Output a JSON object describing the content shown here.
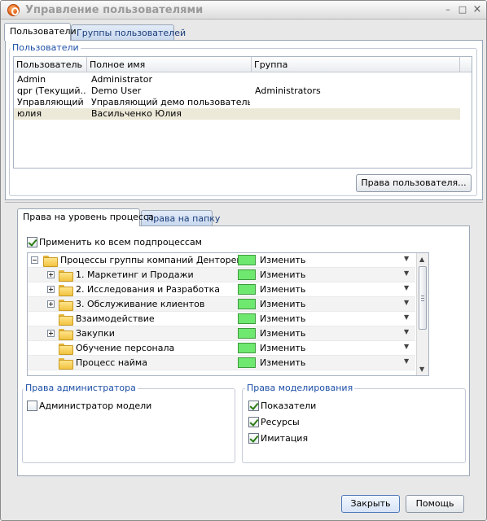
{
  "window": {
    "title": "Управление пользователями",
    "controls": [
      "–",
      "□",
      "×"
    ]
  },
  "top_tabs": [
    {
      "label": "Пользователи",
      "active": true
    },
    {
      "label": "Группы пользователей",
      "active": false
    }
  ],
  "users_group": {
    "label": "Пользователи",
    "columns": [
      "Пользователь",
      "Полное имя",
      "Группа"
    ],
    "rows": [
      {
        "user": "Admin",
        "full_name": "Administrator",
        "group": "",
        "selected": false
      },
      {
        "user": "qpr (Текущий...",
        "full_name": "Demo User",
        "group": "Administrators",
        "selected": false
      },
      {
        "user": "Управляющий",
        "full_name": "Управляющий демо пользователь",
        "group": "",
        "selected": false
      },
      {
        "user": "юлия",
        "full_name": "Васильченко Юлия",
        "group": "",
        "selected": true
      }
    ],
    "rights_button": "Права пользователя..."
  },
  "sub_tabs": [
    {
      "label": "Права на уровень процесса",
      "active": true
    },
    {
      "label": "Права на папку",
      "active": false
    }
  ],
  "apply_all": {
    "label": "Применить ко всем подпроцессам",
    "checked": true
  },
  "tree": {
    "rows": [
      {
        "text": "Процессы группы компаний Денторекс",
        "expander": "minus",
        "indent": 0,
        "permission": "Изменить"
      },
      {
        "text": "1. Маркетинг и Продажи",
        "expander": "plus",
        "indent": 1,
        "permission": "Изменить"
      },
      {
        "text": "2. Исследования и Разработка",
        "expander": "plus",
        "indent": 1,
        "permission": "Изменить"
      },
      {
        "text": "3. Обслуживание клиентов",
        "expander": "plus",
        "indent": 1,
        "permission": "Изменить"
      },
      {
        "text": "Взаимодействие",
        "expander": "none",
        "indent": 1,
        "permission": "Изменить"
      },
      {
        "text": "Закупки",
        "expander": "plus",
        "indent": 1,
        "permission": "Изменить"
      },
      {
        "text": "Обучение персонала",
        "expander": "none",
        "indent": 1,
        "permission": "Изменить"
      },
      {
        "text": "Процесс найма",
        "expander": "none",
        "indent": 1,
        "permission": "Изменить"
      }
    ],
    "permission_color": "#6fe870"
  },
  "admin_rights": {
    "label": "Права администратора",
    "items": [
      {
        "label": "Администратор модели",
        "checked": false
      }
    ]
  },
  "modeling_rights": {
    "label": "Права моделирования",
    "items": [
      {
        "label": "Показатели",
        "checked": true
      },
      {
        "label": "Ресурсы",
        "checked": true
      },
      {
        "label": "Имитация",
        "checked": true
      }
    ]
  },
  "footer": {
    "close": "Закрыть",
    "help": "Помощь"
  }
}
